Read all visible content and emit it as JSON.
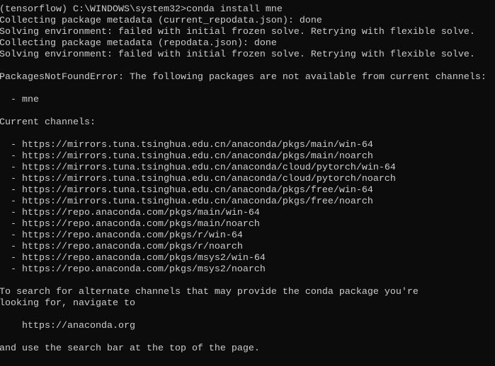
{
  "terminal": {
    "colors": {
      "background": "#0c0c0c",
      "text": "#cccccc"
    },
    "lines": [
      "(tensorflow) C:\\WINDOWS\\system32>conda install mne",
      "Collecting package metadata (current_repodata.json): done",
      "Solving environment: failed with initial frozen solve. Retrying with flexible solve.",
      "Collecting package metadata (repodata.json): done",
      "Solving environment: failed with initial frozen solve. Retrying with flexible solve.",
      "",
      "PackagesNotFoundError: The following packages are not available from current channels:",
      "",
      "  - mne",
      "",
      "Current channels:",
      "",
      "  - https://mirrors.tuna.tsinghua.edu.cn/anaconda/pkgs/main/win-64",
      "  - https://mirrors.tuna.tsinghua.edu.cn/anaconda/pkgs/main/noarch",
      "  - https://mirrors.tuna.tsinghua.edu.cn/anaconda/cloud/pytorch/win-64",
      "  - https://mirrors.tuna.tsinghua.edu.cn/anaconda/cloud/pytorch/noarch",
      "  - https://mirrors.tuna.tsinghua.edu.cn/anaconda/pkgs/free/win-64",
      "  - https://mirrors.tuna.tsinghua.edu.cn/anaconda/pkgs/free/noarch",
      "  - https://repo.anaconda.com/pkgs/main/win-64",
      "  - https://repo.anaconda.com/pkgs/main/noarch",
      "  - https://repo.anaconda.com/pkgs/r/win-64",
      "  - https://repo.anaconda.com/pkgs/r/noarch",
      "  - https://repo.anaconda.com/pkgs/msys2/win-64",
      "  - https://repo.anaconda.com/pkgs/msys2/noarch",
      "",
      "To search for alternate channels that may provide the conda package you're",
      "looking for, navigate to",
      "",
      "    https://anaconda.org",
      "",
      "and use the search bar at the top of the page."
    ]
  }
}
